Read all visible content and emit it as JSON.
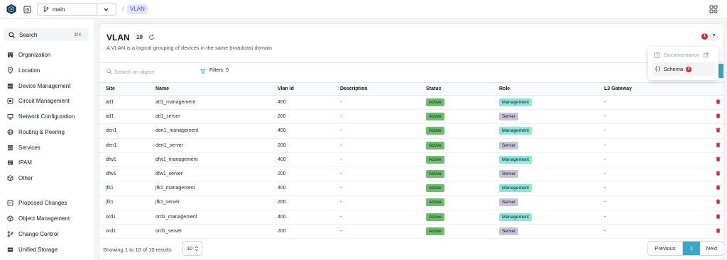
{
  "header": {
    "branch": "main",
    "breadcrumb_sep": "/",
    "breadcrumb": "VLAN"
  },
  "sidebar": {
    "search_label": "Search",
    "search_shortcut": "⌘K",
    "items": [
      {
        "label": "Organization",
        "icon": "building-icon"
      },
      {
        "label": "Location",
        "icon": "pin-icon"
      },
      {
        "label": "Device Management",
        "icon": "server-icon"
      },
      {
        "label": "Circuit Management",
        "icon": "circuit-icon"
      },
      {
        "label": "Network Configuration",
        "icon": "network-icon"
      },
      {
        "label": "Routing & Peering",
        "icon": "globe-icon"
      },
      {
        "label": "Services",
        "icon": "layers-icon"
      },
      {
        "label": "IPAM",
        "icon": "ipam-icon"
      },
      {
        "label": "Other",
        "icon": "cube-icon"
      },
      {
        "label": "Proposed Changes",
        "icon": "proposed-changes-icon"
      },
      {
        "label": "Object Management",
        "icon": "object-cube-icon"
      },
      {
        "label": "Change Control",
        "icon": "branch-icon"
      },
      {
        "label": "Unified Storage",
        "icon": "storage-icon"
      }
    ]
  },
  "main": {
    "title": "VLAN",
    "count": "10",
    "subtitle": "A VLAN is a logical grouping of devices in the same broadcast domain",
    "notification_count": "1",
    "help": "?",
    "search_placeholder": "Search an object",
    "filters_label": "Filters: 0",
    "columns": [
      "Site",
      "Name",
      "Vlan Id",
      "Description",
      "Status",
      "Role",
      "L3 Gateway"
    ],
    "rows": [
      {
        "site": "atl1",
        "name": "atl1_management",
        "vlan_id": "400",
        "description": "-",
        "status": "Active",
        "role": "Management",
        "l3_gateway": "-"
      },
      {
        "site": "atl1",
        "name": "atl1_server",
        "vlan_id": "200",
        "description": "-",
        "status": "Active",
        "role": "Server",
        "l3_gateway": "-"
      },
      {
        "site": "den1",
        "name": "den1_management",
        "vlan_id": "400",
        "description": "-",
        "status": "Active",
        "role": "Management",
        "l3_gateway": "-"
      },
      {
        "site": "den1",
        "name": "den1_server",
        "vlan_id": "200",
        "description": "-",
        "status": "Active",
        "role": "Server",
        "l3_gateway": "-"
      },
      {
        "site": "dfw1",
        "name": "dfw1_management",
        "vlan_id": "400",
        "description": "-",
        "status": "Active",
        "role": "Management",
        "l3_gateway": "-"
      },
      {
        "site": "dfw1",
        "name": "dfw1_server",
        "vlan_id": "200",
        "description": "-",
        "status": "Active",
        "role": "Server",
        "l3_gateway": "-"
      },
      {
        "site": "jfk1",
        "name": "jfk1_management",
        "vlan_id": "400",
        "description": "-",
        "status": "Active",
        "role": "Management",
        "l3_gateway": "-"
      },
      {
        "site": "jfk1",
        "name": "jfk1_server",
        "vlan_id": "200",
        "description": "-",
        "status": "Active",
        "role": "Server",
        "l3_gateway": "-"
      },
      {
        "site": "ord1",
        "name": "ord1_management",
        "vlan_id": "400",
        "description": "-",
        "status": "Active",
        "role": "Management",
        "l3_gateway": "-"
      },
      {
        "site": "ord1",
        "name": "ord1_server",
        "vlan_id": "200",
        "description": "-",
        "status": "Active",
        "role": "Server",
        "l3_gateway": "-"
      }
    ],
    "footer": {
      "results_text": "Showing 1 to 10 of 10 results",
      "per_page": "10",
      "previous": "Previous",
      "current_page": "1",
      "next": "Next"
    }
  },
  "dropdown": {
    "documentation": "Documentation",
    "schema": "Schema",
    "schema_badge": "2"
  },
  "colors": {
    "accent": "#38a8c8",
    "status_active": "#6dbb6d",
    "role_management": "#8ee6d9",
    "role_server": "#c9c3da",
    "danger": "#dc2626"
  }
}
